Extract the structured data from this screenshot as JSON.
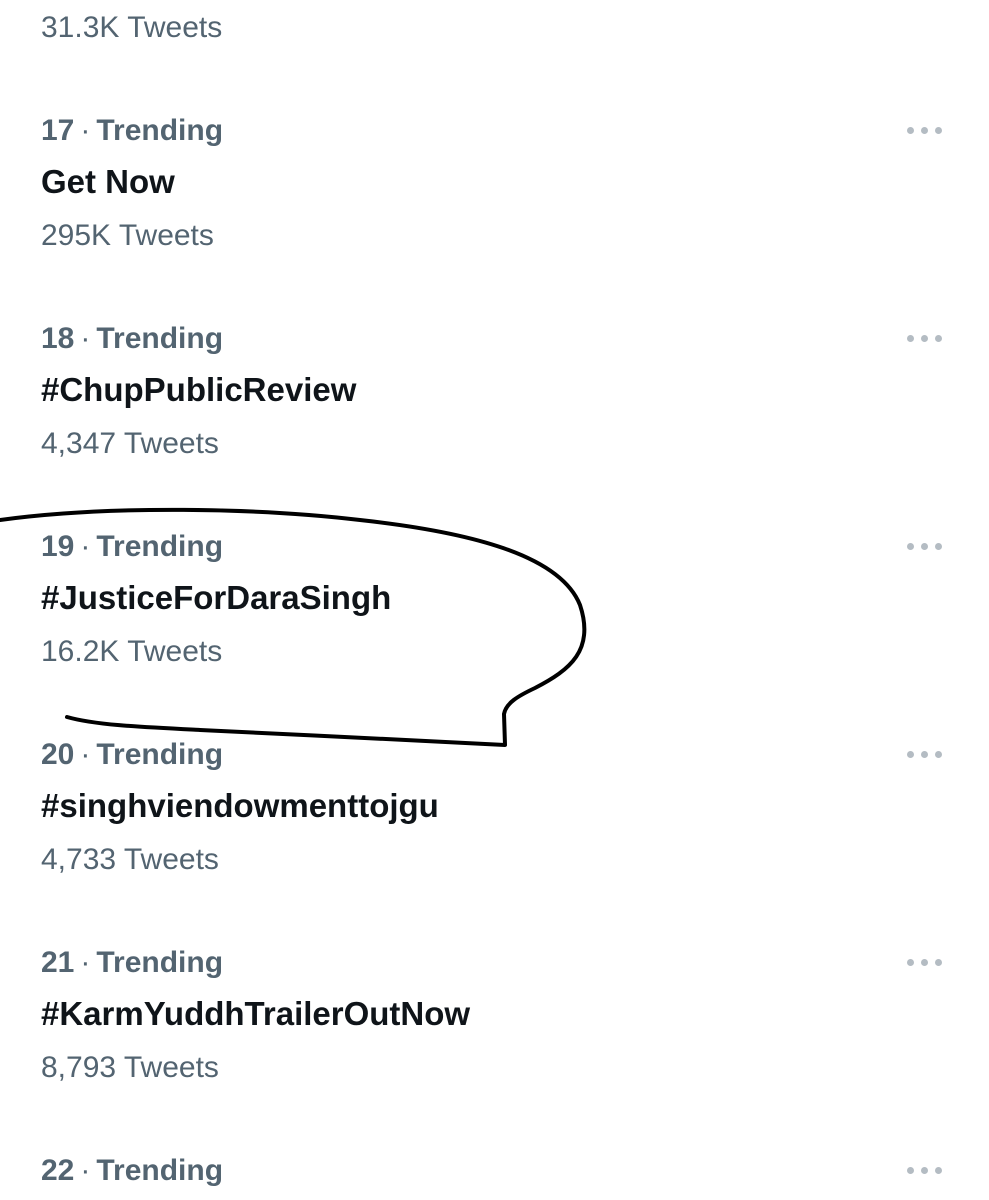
{
  "top_partial": {
    "count": "31.3K Tweets"
  },
  "trends": [
    {
      "rank": "17",
      "label": "Trending",
      "topic": "Get Now",
      "count": "295K Tweets",
      "more_icon": "more-horizontal-icon"
    },
    {
      "rank": "18",
      "label": "Trending",
      "topic": "#ChupPublicReview",
      "count": "4,347 Tweets",
      "more_icon": "more-horizontal-icon"
    },
    {
      "rank": "19",
      "label": "Trending",
      "topic": "#JusticeForDaraSingh",
      "count": "16.2K Tweets",
      "more_icon": "more-horizontal-icon"
    },
    {
      "rank": "20",
      "label": "Trending",
      "topic": "#singhviendowmenttojgu",
      "count": "4,733 Tweets",
      "more_icon": "more-horizontal-icon"
    },
    {
      "rank": "21",
      "label": "Trending",
      "topic": "#KarmYuddhTrailerOutNow",
      "count": "8,793 Tweets",
      "more_icon": "more-horizontal-icon"
    },
    {
      "rank": "22",
      "label": "Trending",
      "topic": "",
      "count": "",
      "more_icon": "more-horizontal-icon"
    }
  ],
  "separator": "·",
  "colors": {
    "secondary_text": "#536471",
    "primary_text": "#0f1419",
    "more_dots": "#b4bcc3",
    "annotation": "#000000"
  }
}
